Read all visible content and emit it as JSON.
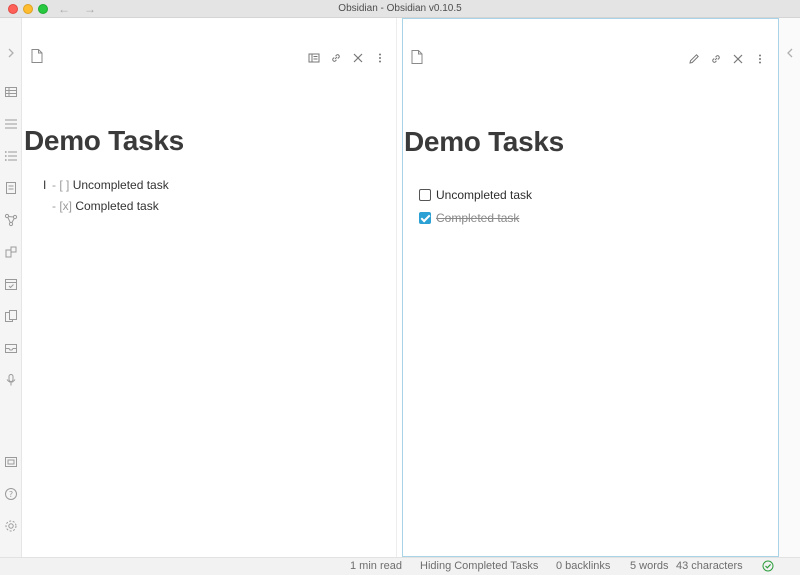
{
  "window": {
    "title": "Obsidian - Obsidian v0.10.5"
  },
  "nav": {
    "back": "←",
    "forward": "→"
  },
  "ribbon": {
    "collapse": "›",
    "icons": [
      "table-icon",
      "lines-icon",
      "list-icon",
      "note-icon",
      "graph-icon",
      "plugin-icon",
      "calendar-icon",
      "files-icon",
      "inbox-icon",
      "microphone-icon",
      "vault-icon",
      "help-icon",
      "settings-icon"
    ]
  },
  "left_pane": {
    "heading": "Demo Tasks",
    "lines": [
      {
        "marker": "- [ ]",
        "text": "Uncompleted task"
      },
      {
        "marker": "- [x]",
        "text": "Completed task"
      }
    ]
  },
  "right_pane": {
    "heading": "Demo Tasks",
    "tasks": [
      {
        "text": "Uncompleted task",
        "checked": false
      },
      {
        "text": "Completed task",
        "checked": true
      }
    ]
  },
  "status": {
    "read_time": "1 min read",
    "plugin": "Hiding Completed Tasks",
    "backlinks": "0 backlinks",
    "words": "5 words",
    "characters": "43 characters"
  },
  "colors": {
    "accent": "#2aa0d4",
    "pane_border": "#a9d3e6"
  }
}
